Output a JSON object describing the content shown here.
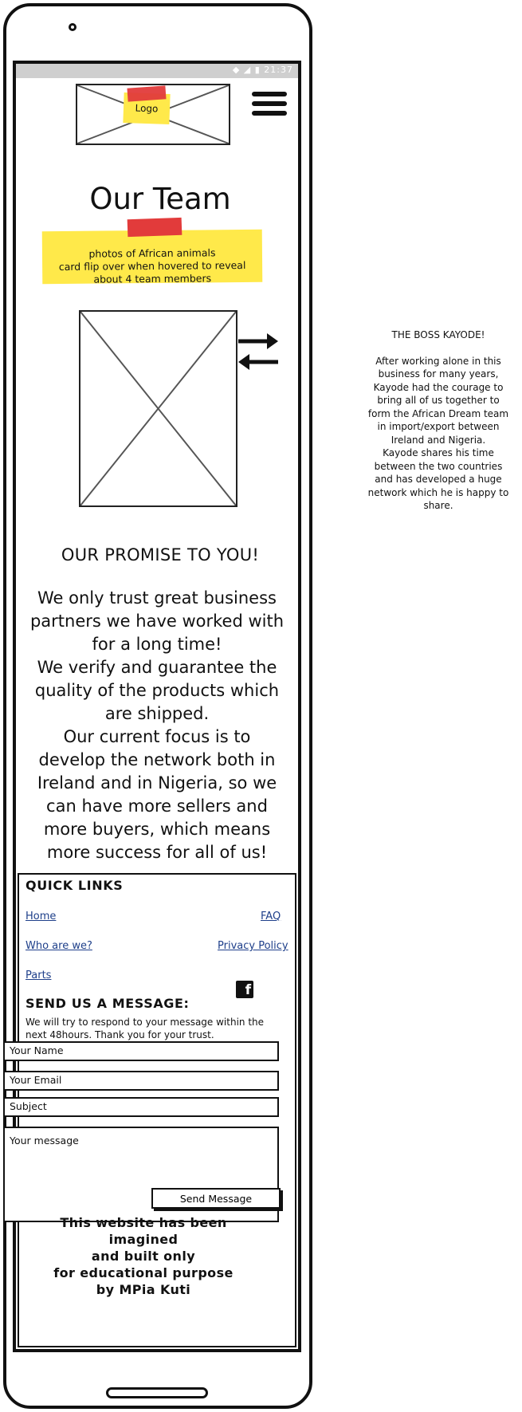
{
  "status_bar": {
    "time": "21:37",
    "icons": "◆ ◢ ▮"
  },
  "header": {
    "logo_label": "Logo",
    "menu_icon": "hamburger-menu-icon"
  },
  "team": {
    "title": "Our Team",
    "note_lines": [
      "photos of African animals",
      "card flip over when hovered to reveal",
      "about 4 team members"
    ],
    "flip_icon": "swap-arrows-icon"
  },
  "promise": {
    "title": "OUR PROMISE TO YOU!",
    "lines": [
      "We only trust great business",
      "partners we have worked with",
      "for a long time!",
      "We verify and guarantee the",
      "quality of the products which",
      "are shipped.",
      "Our current focus is to",
      "develop the network both in",
      "Ireland and in Nigeria, so we",
      "can have more sellers and",
      "more buyers, which means",
      "more success for all of us!"
    ]
  },
  "footer": {
    "quick_links_title": "QUICK LINKS",
    "links": {
      "home": "Home",
      "faq": "FAQ",
      "who": "Who are we?",
      "privacy": "Privacy Policy",
      "parts": "Parts"
    },
    "social_icon": "facebook-icon",
    "message_title": "SEND US A MESSAGE:",
    "message_intro_1": "We will try to respond to your message within the",
    "message_intro_2": "next 48hours. Thank you for your trust.",
    "fields": {
      "name": "Your Name",
      "email": "Your Email",
      "subject": "Subject",
      "message": "Your message"
    },
    "send_label": "Send Message",
    "credit_lines": [
      "This website has been imagined",
      "and built only",
      "for educational purpose",
      "by MPia Kuti"
    ]
  },
  "side_card": {
    "title": "THE BOSS KAYODE!",
    "lines": [
      "After working alone in this",
      "business for many years,",
      "Kayode had the courage to",
      "bring all of us together to",
      "form the African Dream team",
      "in import/export between",
      "Ireland and Nigeria.",
      "Kayode shares his time",
      "between the two countries",
      "and has developed a huge",
      "network which he is happy to",
      "share."
    ]
  },
  "colors": {
    "note_yellow": "#ffe94a",
    "tape_red": "#e23b3b",
    "link_blue": "#1e3f8a",
    "status_grey": "#cfcfcf"
  }
}
